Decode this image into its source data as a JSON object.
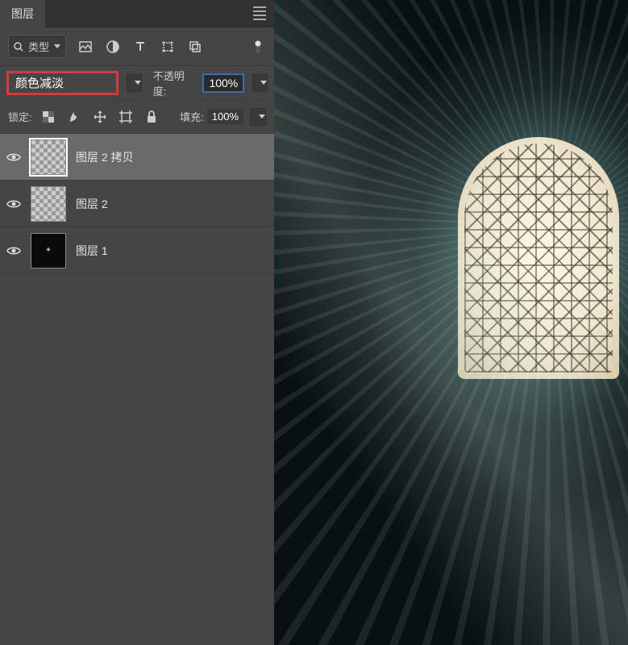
{
  "panel": {
    "title": "图层",
    "filter_label": "类型",
    "blend_mode": "颜色减淡",
    "opacity_label": "不透明度:",
    "opacity_value": "100%",
    "lock_label": "锁定:",
    "fill_label": "填充:",
    "fill_value": "100%"
  },
  "layers": [
    {
      "name": "图层 2 拷贝",
      "visible": true,
      "selected": true,
      "thumb": "checker"
    },
    {
      "name": "图层 2",
      "visible": true,
      "selected": false,
      "thumb": "checker"
    },
    {
      "name": "图层 1",
      "visible": true,
      "selected": false,
      "thumb": "dark"
    }
  ]
}
